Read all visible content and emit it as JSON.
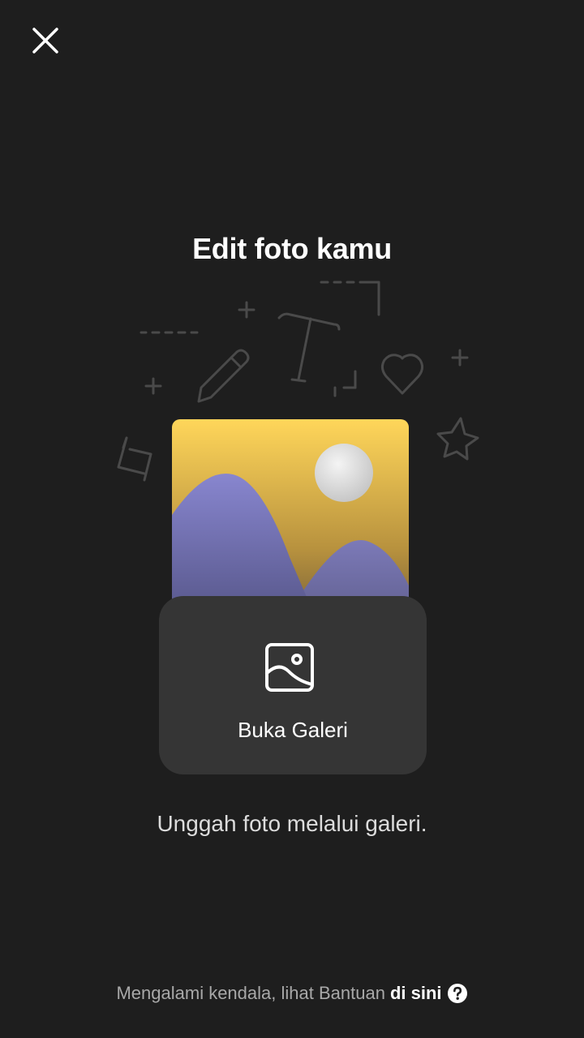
{
  "header": {
    "close_icon": "close-icon"
  },
  "main": {
    "title": "Edit foto kamu",
    "illustration_icons": [
      "crop-icon",
      "pencil-icon",
      "text-icon",
      "heart-icon",
      "star-icon",
      "plus-icon",
      "corner-frame-icon"
    ],
    "gallery_button": {
      "label": "Buka Galeri",
      "icon": "image-icon"
    },
    "subtitle": "Unggah foto melalui galeri."
  },
  "footer": {
    "help_text": "Mengalami kendala, lihat Bantuan",
    "help_link": "di sini",
    "help_icon": "question-circle-icon"
  },
  "colors": {
    "background": "#1e1e1e",
    "card": "#353535",
    "illustration_yellow": "#f2c94c",
    "illustration_purple": "#7d7cc4"
  }
}
